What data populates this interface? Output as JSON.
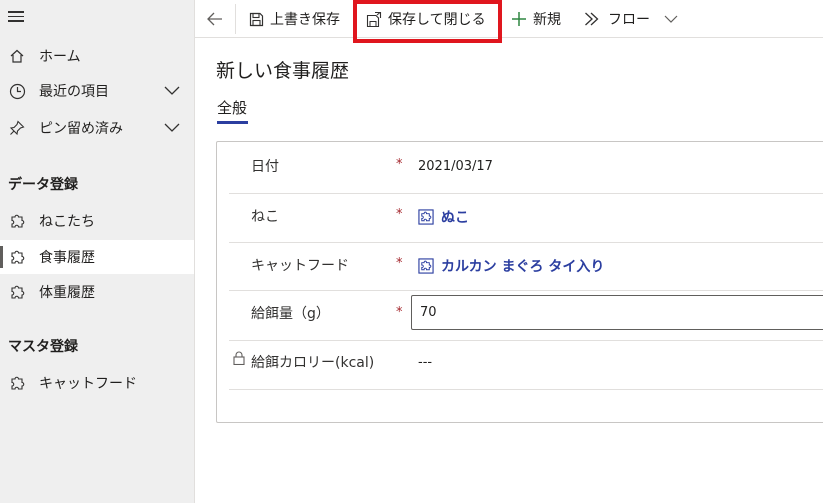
{
  "sidebar": {
    "items": [
      {
        "label": "ホーム",
        "icon": "home-icon"
      },
      {
        "label": "最近の項目",
        "icon": "clock-icon"
      },
      {
        "label": "ピン留め済み",
        "icon": "pin-icon"
      }
    ],
    "section1": {
      "title": "データ登録",
      "items": [
        {
          "label": "ねこたち",
          "icon": "puzzle-icon"
        },
        {
          "label": "食事履歴",
          "icon": "puzzle-icon",
          "active": true
        },
        {
          "label": "体重履歴",
          "icon": "puzzle-icon"
        }
      ]
    },
    "section2": {
      "title": "マスタ登録",
      "items": [
        {
          "label": "キャットフード",
          "icon": "puzzle-icon"
        }
      ]
    }
  },
  "toolbar": {
    "save_label": "上書き保存",
    "save_close_label": "保存して閉じる",
    "new_label": "新規",
    "flow_label": "フロー"
  },
  "form": {
    "title": "新しい食事履歴",
    "tab": "全般",
    "required_mark": "*",
    "fields": {
      "date": {
        "label": "日付",
        "value": "2021/03/17"
      },
      "cat": {
        "label": "ねこ",
        "value": "ぬこ"
      },
      "food": {
        "label": "キャットフード",
        "value": "カルカン まぐろ タイ入り"
      },
      "amount": {
        "label": "給餌量（g）",
        "value": "70"
      },
      "calorie": {
        "label": "給餌カロリー(kcal)",
        "value": "---"
      }
    }
  },
  "colors": {
    "accent": "#2b3ea0",
    "highlight": "#e0161e",
    "required": "#a4262c",
    "sidebar_bg": "#efefef"
  }
}
